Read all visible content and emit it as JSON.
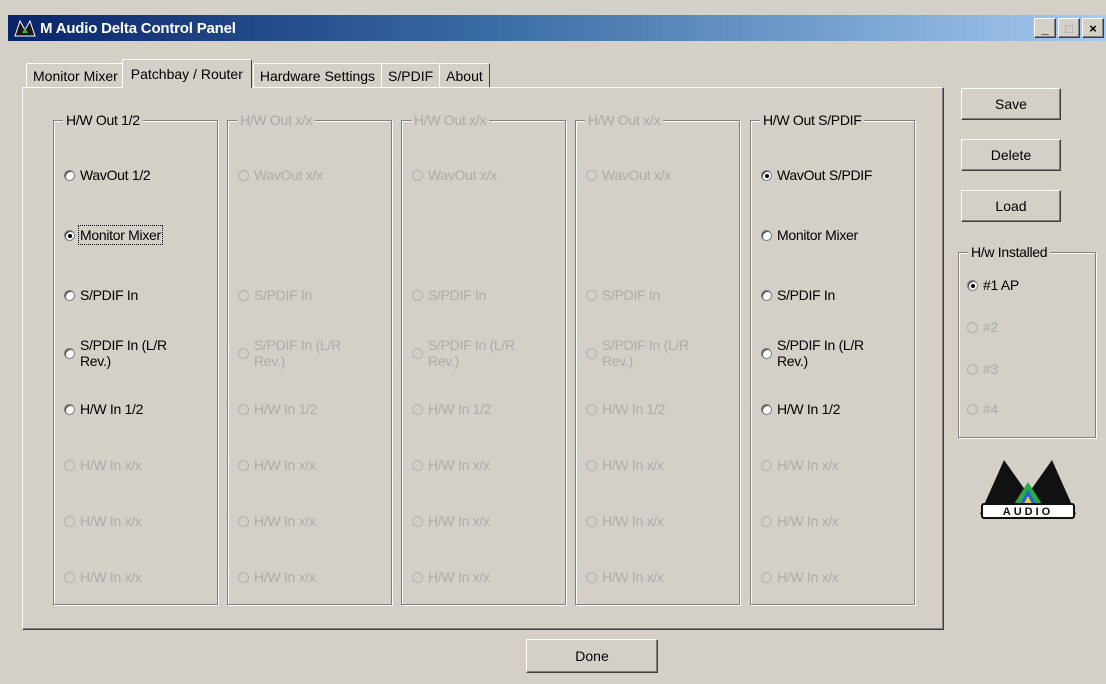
{
  "window": {
    "title": "M Audio Delta Control Panel",
    "controls": {
      "minimize": "_",
      "maximize": "□",
      "close": "×"
    }
  },
  "tabs": [
    {
      "label": "Monitor Mixer",
      "active": false
    },
    {
      "label": "Patchbay / Router",
      "active": true
    },
    {
      "label": "Hardware Settings",
      "active": false
    },
    {
      "label": "S/PDIF",
      "active": false
    },
    {
      "label": "About",
      "active": false
    }
  ],
  "groups": [
    {
      "legend": "H/W Out 1/2",
      "enabled": true,
      "options": [
        {
          "label": "WavOut 1/2",
          "enabled": true,
          "selected": false
        },
        {
          "label": "Monitor Mixer",
          "enabled": true,
          "selected": true,
          "focused": true
        },
        {
          "label": "S/PDIF In",
          "enabled": true,
          "selected": false
        },
        {
          "label": "S/PDIF In (L/R Rev.)",
          "enabled": true,
          "selected": false
        },
        {
          "label": "H/W In 1/2",
          "enabled": true,
          "selected": false
        },
        {
          "label": "H/W In x/x",
          "enabled": false,
          "selected": false
        },
        {
          "label": "H/W In x/x",
          "enabled": false,
          "selected": false
        },
        {
          "label": "H/W In x/x",
          "enabled": false,
          "selected": false
        }
      ]
    },
    {
      "legend": "H/W Out x/x",
      "enabled": false,
      "options": [
        {
          "label": "WavOut x/x",
          "enabled": false,
          "selected": false
        },
        null,
        {
          "label": "S/PDIF In",
          "enabled": false,
          "selected": false
        },
        {
          "label": "S/PDIF In (L/R Rev.)",
          "enabled": false,
          "selected": false
        },
        {
          "label": "H/W In 1/2",
          "enabled": false,
          "selected": false
        },
        {
          "label": "H/W In x/x",
          "enabled": false,
          "selected": false
        },
        {
          "label": "H/W In x/x",
          "enabled": false,
          "selected": false
        },
        {
          "label": "H/W In x/x",
          "enabled": false,
          "selected": false
        }
      ]
    },
    {
      "legend": "H/W Out x/x",
      "enabled": false,
      "options": [
        {
          "label": "WavOut x/x",
          "enabled": false,
          "selected": false
        },
        null,
        {
          "label": "S/PDIF In",
          "enabled": false,
          "selected": false
        },
        {
          "label": "S/PDIF In (L/R Rev.)",
          "enabled": false,
          "selected": false
        },
        {
          "label": "H/W In 1/2",
          "enabled": false,
          "selected": false
        },
        {
          "label": "H/W In x/x",
          "enabled": false,
          "selected": false
        },
        {
          "label": "H/W In x/x",
          "enabled": false,
          "selected": false
        },
        {
          "label": "H/W In x/x",
          "enabled": false,
          "selected": false
        }
      ]
    },
    {
      "legend": "H/W Out x/x",
      "enabled": false,
      "options": [
        {
          "label": "WavOut x/x",
          "enabled": false,
          "selected": false
        },
        null,
        {
          "label": "S/PDIF In",
          "enabled": false,
          "selected": false
        },
        {
          "label": "S/PDIF In (L/R Rev.)",
          "enabled": false,
          "selected": false
        },
        {
          "label": "H/W In 1/2",
          "enabled": false,
          "selected": false
        },
        {
          "label": "H/W In x/x",
          "enabled": false,
          "selected": false
        },
        {
          "label": "H/W In x/x",
          "enabled": false,
          "selected": false
        },
        {
          "label": "H/W In x/x",
          "enabled": false,
          "selected": false
        }
      ]
    },
    {
      "legend": "H/W Out S/PDIF",
      "enabled": true,
      "options": [
        {
          "label": "WavOut S/PDIF",
          "enabled": true,
          "selected": true
        },
        {
          "label": "Monitor Mixer",
          "enabled": true,
          "selected": false
        },
        {
          "label": "S/PDIF In",
          "enabled": true,
          "selected": false
        },
        {
          "label": "S/PDIF In (L/R Rev.)",
          "enabled": true,
          "selected": false
        },
        {
          "label": "H/W In 1/2",
          "enabled": true,
          "selected": false
        },
        {
          "label": "H/W In x/x",
          "enabled": false,
          "selected": false
        },
        {
          "label": "H/W In x/x",
          "enabled": false,
          "selected": false
        },
        {
          "label": "H/W In x/x",
          "enabled": false,
          "selected": false
        }
      ]
    }
  ],
  "side_buttons": {
    "save": "Save",
    "delete": "Delete",
    "load": "Load"
  },
  "hw_installed": {
    "legend": "H/w Installed",
    "options": [
      {
        "label": "#1 AP",
        "enabled": true,
        "selected": true
      },
      {
        "label": "#2",
        "enabled": false,
        "selected": false
      },
      {
        "label": "#3",
        "enabled": false,
        "selected": false
      },
      {
        "label": "#4",
        "enabled": false,
        "selected": false
      }
    ]
  },
  "logo": {
    "text": "AUDIO",
    "icon": "m-audio-logo-icon"
  },
  "done_button": "Done",
  "colors": {
    "titlebar_start": "#0a246a",
    "titlebar_end": "#a6caf0",
    "face": "#d4d0c8",
    "disabled_text": "#ababab"
  }
}
